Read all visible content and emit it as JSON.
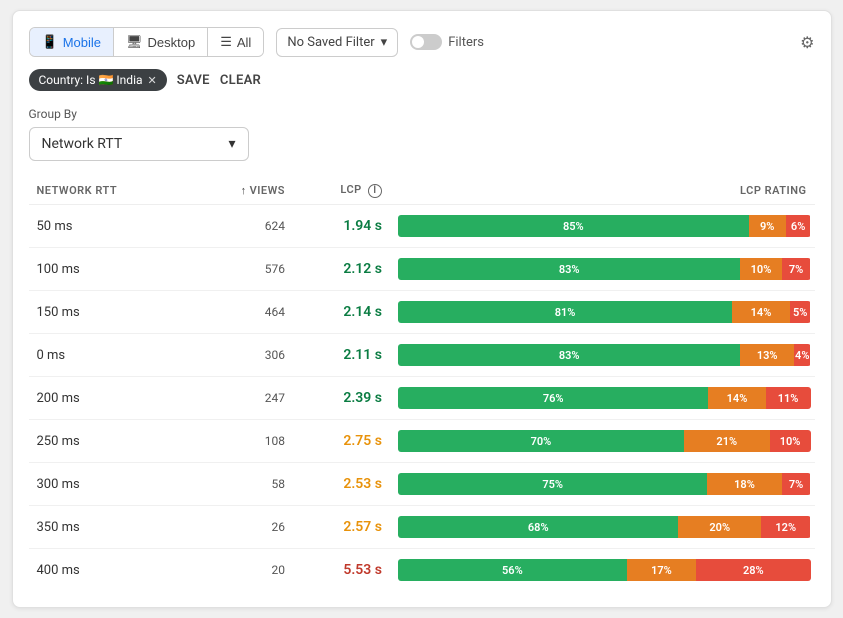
{
  "toolbar": {
    "device_tabs": [
      {
        "id": "mobile",
        "label": "Mobile",
        "icon": "📱",
        "active": true
      },
      {
        "id": "desktop",
        "label": "Desktop",
        "icon": "🖥",
        "active": false
      },
      {
        "id": "all",
        "label": "All",
        "icon": "📋",
        "active": false
      }
    ],
    "filter_dropdown_label": "No Saved Filter",
    "filters_label": "Filters",
    "gear_icon": "⚙"
  },
  "filter_bar": {
    "tag_label": "Country: Is 🇮🇳 India",
    "tag_close": "✕",
    "save_label": "SAVE",
    "clear_label": "CLEAR"
  },
  "group_by": {
    "label": "Group By",
    "value": "Network RTT",
    "dropdown_icon": "▾"
  },
  "table": {
    "columns": [
      {
        "id": "network_rtt",
        "label": "NETWORK RTT"
      },
      {
        "id": "views",
        "label": "↑ VIEWS",
        "sorted": true
      },
      {
        "id": "lcp",
        "label": "LCP",
        "has_info": true
      },
      {
        "id": "lcp_rating",
        "label": "LCP RATING"
      }
    ],
    "rows": [
      {
        "rtt": "50 ms",
        "views": "624",
        "lcp": "1.94 s",
        "lcp_class": "lcp-good",
        "green": 85,
        "orange": 9,
        "red": 6
      },
      {
        "rtt": "100 ms",
        "views": "576",
        "lcp": "2.12 s",
        "lcp_class": "lcp-good",
        "green": 83,
        "orange": 10,
        "red": 7
      },
      {
        "rtt": "150 ms",
        "views": "464",
        "lcp": "2.14 s",
        "lcp_class": "lcp-good",
        "green": 81,
        "orange": 14,
        "red": 5
      },
      {
        "rtt": "0 ms",
        "views": "306",
        "lcp": "2.11 s",
        "lcp_class": "lcp-good",
        "green": 83,
        "orange": 13,
        "red": 4
      },
      {
        "rtt": "200 ms",
        "views": "247",
        "lcp": "2.39 s",
        "lcp_class": "lcp-good",
        "green": 76,
        "orange": 14,
        "red": 11
      },
      {
        "rtt": "250 ms",
        "views": "108",
        "lcp": "2.75 s",
        "lcp_class": "lcp-ok",
        "green": 70,
        "orange": 21,
        "red": 10
      },
      {
        "rtt": "300 ms",
        "views": "58",
        "lcp": "2.53 s",
        "lcp_class": "lcp-ok",
        "green": 75,
        "orange": 18,
        "red": 7
      },
      {
        "rtt": "350 ms",
        "views": "26",
        "lcp": "2.57 s",
        "lcp_class": "lcp-ok",
        "green": 68,
        "orange": 20,
        "red": 12
      },
      {
        "rtt": "400 ms",
        "views": "20",
        "lcp": "5.53 s",
        "lcp_class": "lcp-bad",
        "green": 56,
        "orange": 17,
        "red": 28
      }
    ]
  }
}
